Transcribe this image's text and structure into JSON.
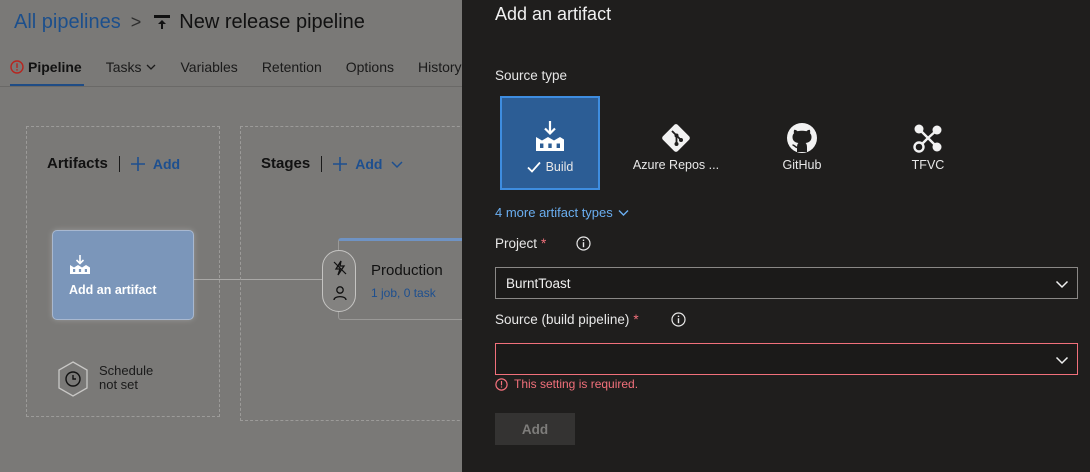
{
  "breadcrumb": {
    "root": "All pipelines",
    "separator": ">",
    "title": "New release pipeline"
  },
  "tabs": [
    {
      "label": "Pipeline",
      "active": true,
      "warning": true
    },
    {
      "label": "Tasks",
      "has_dropdown": true
    },
    {
      "label": "Variables"
    },
    {
      "label": "Retention"
    },
    {
      "label": "Options"
    },
    {
      "label": "History"
    }
  ],
  "artifacts": {
    "title": "Artifacts",
    "add_label": "Add",
    "card_label": "Add an artifact",
    "card_icon": "build-icon"
  },
  "schedule": {
    "line1": "Schedule",
    "line2": "not set",
    "icon": "clock-icon"
  },
  "stages": {
    "title": "Stages",
    "add_label": "Add",
    "stage": {
      "name": "Production",
      "summary": "1 job, 0 task"
    }
  },
  "panel": {
    "title": "Add an artifact",
    "source_type_label": "Source type",
    "source_types": [
      {
        "label": "Build",
        "icon": "build-icon",
        "selected": true
      },
      {
        "label": "Azure Repos ...",
        "icon": "git-icon"
      },
      {
        "label": "GitHub",
        "icon": "github-icon"
      },
      {
        "label": "TFVC",
        "icon": "tfvc-icon"
      }
    ],
    "more_types": "4 more artifact types",
    "project": {
      "label": "Project",
      "required": "*",
      "value": "BurntToast"
    },
    "source": {
      "label": "Source (build pipeline)",
      "required": "*",
      "value": "",
      "error": "This setting is required."
    },
    "add_button": "Add"
  },
  "colors": {
    "accent": "#3e8de0",
    "error": "#f1707b",
    "link": "#6aaef0",
    "panel_bg": "#1f1e1d",
    "selected_tile": "#2c5d95"
  }
}
